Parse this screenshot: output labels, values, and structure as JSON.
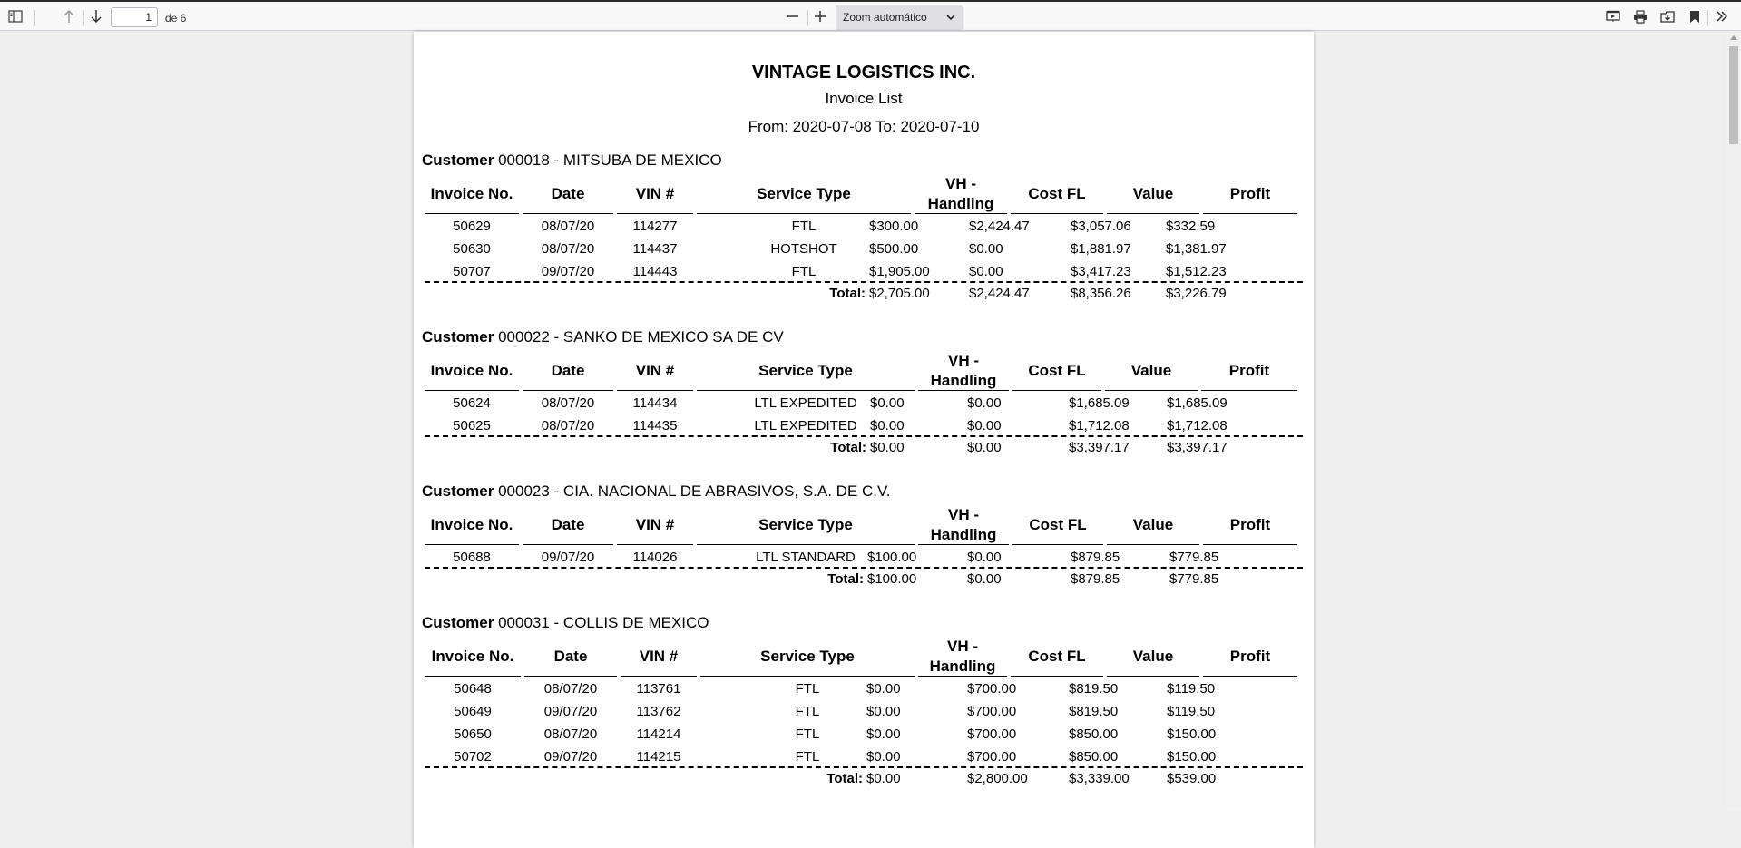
{
  "viewer": {
    "page_number": "1",
    "page_count_label": "de 6",
    "zoom_label": "Zoom automático"
  },
  "report": {
    "company": "VINTAGE LOGISTICS INC.",
    "title": "Invoice List",
    "range": "From: 2020-07-08 To: 2020-07-10"
  },
  "labels": {
    "customer": "Customer",
    "total": "Total:"
  },
  "columns": [
    "Invoice No.",
    "Date",
    "VIN #",
    "Service Type",
    "VH -\nHandling",
    "Cost FL",
    "Value",
    "Profit"
  ],
  "sections": [
    {
      "customer": "000018 - MITSUBA DE MEXICO",
      "rows": [
        [
          "50629",
          "08/07/20",
          "114277",
          "FTL",
          "$300.00",
          "$2,424.47",
          "$3,057.06",
          "$332.59"
        ],
        [
          "50630",
          "08/07/20",
          "114437",
          "HOTSHOT",
          "$500.00",
          "$0.00",
          "$1,881.97",
          "$1,381.97"
        ],
        [
          "50707",
          "09/07/20",
          "114443",
          "FTL",
          "$1,905.00",
          "$0.00",
          "$3,417.23",
          "$1,512.23"
        ]
      ],
      "totals": [
        "$2,705.00",
        "$2,424.47",
        "$8,356.26",
        "$3,226.79"
      ]
    },
    {
      "customer": "000022 - SANKO DE MEXICO SA DE CV",
      "rows": [
        [
          "50624",
          "08/07/20",
          "114434",
          "LTL EXPEDITED",
          "$0.00",
          "$0.00",
          "$1,685.09",
          "$1,685.09"
        ],
        [
          "50625",
          "08/07/20",
          "114435",
          "LTL EXPEDITED",
          "$0.00",
          "$0.00",
          "$1,712.08",
          "$1,712.08"
        ]
      ],
      "totals": [
        "$0.00",
        "$0.00",
        "$3,397.17",
        "$3,397.17"
      ]
    },
    {
      "customer": "000023 - CIA. NACIONAL DE ABRASIVOS, S.A. DE C.V.",
      "rows": [
        [
          "50688",
          "09/07/20",
          "114026",
          "LTL STANDARD",
          "$100.00",
          "$0.00",
          "$879.85",
          "$779.85"
        ]
      ],
      "totals": [
        "$100.00",
        "$0.00",
        "$879.85",
        "$779.85"
      ]
    },
    {
      "customer": "000031 - COLLIS DE MEXICO",
      "rows": [
        [
          "50648",
          "08/07/20",
          "113761",
          "FTL",
          "$0.00",
          "$700.00",
          "$819.50",
          "$119.50"
        ],
        [
          "50649",
          "09/07/20",
          "113762",
          "FTL",
          "$0.00",
          "$700.00",
          "$819.50",
          "$119.50"
        ],
        [
          "50650",
          "08/07/20",
          "114214",
          "FTL",
          "$0.00",
          "$700.00",
          "$850.00",
          "$150.00"
        ],
        [
          "50702",
          "09/07/20",
          "114215",
          "FTL",
          "$0.00",
          "$700.00",
          "$850.00",
          "$150.00"
        ]
      ],
      "totals": [
        "$0.00",
        "$2,800.00",
        "$3,339.00",
        "$539.00"
      ]
    }
  ]
}
